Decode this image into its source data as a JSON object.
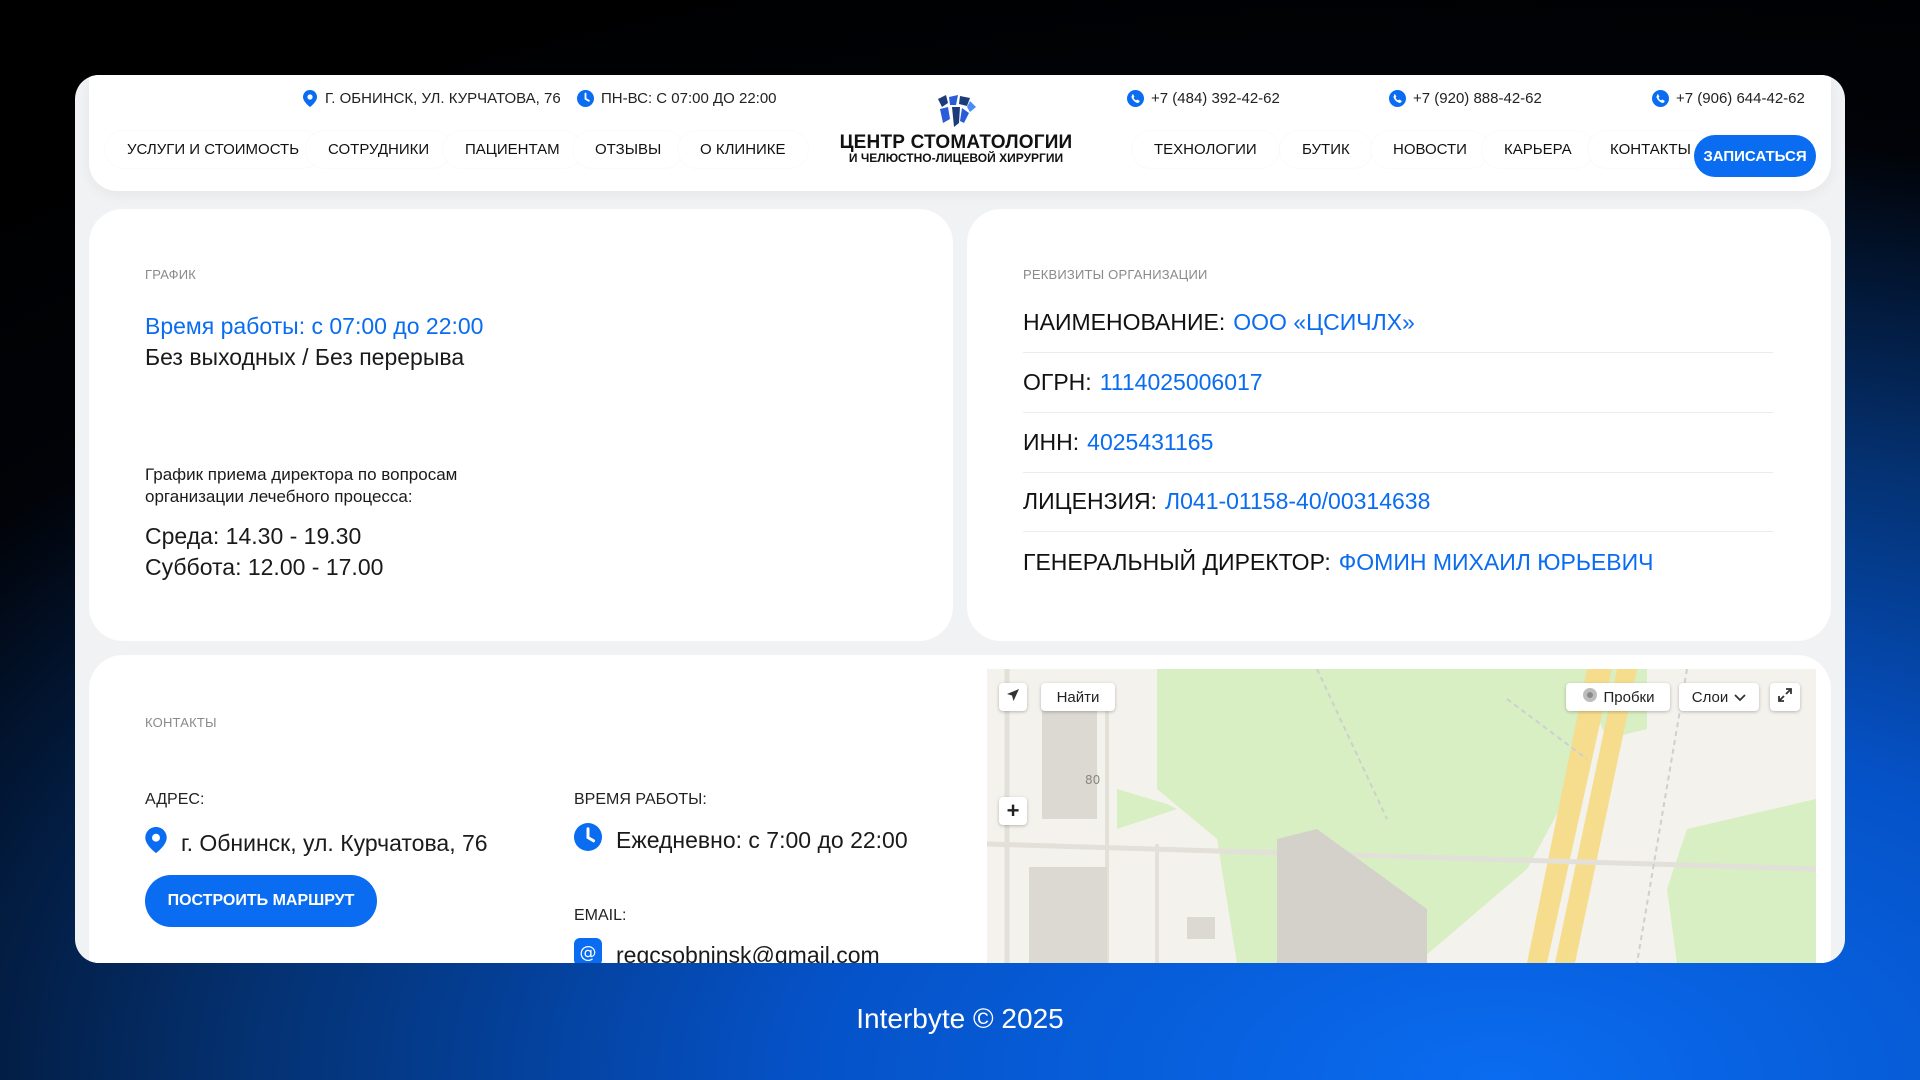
{
  "topbar": {
    "address": "Г. ОБНИНСК, УЛ. КУРЧАТОВА, 76",
    "hours": "ПН-ВС: С 07:00 ДО 22:00",
    "phones": [
      "+7 (484) 392-42-62",
      "+7 (920) 888-42-62",
      "+7 (906) 644-42-62"
    ]
  },
  "logo": {
    "line1": "ЦЕНТР СТОМАТОЛОГИИ",
    "line2": "И ЧЕЛЮСТНО-ЛИЦЕВОЙ ХИРУРГИИ"
  },
  "nav_left": [
    "УСЛУГИ И СТОИМОСТЬ",
    "СОТРУДНИКИ",
    "ПАЦИЕНТАМ",
    "ОТЗЫВЫ",
    "О КЛИНИКЕ"
  ],
  "nav_right": [
    "ТЕХНОЛОГИИ",
    "БУТИК",
    "НОВОСТИ",
    "КАРЬЕРА",
    "КОНТАКТЫ"
  ],
  "nav_cta": "ЗАПИСАТЬСЯ",
  "schedule": {
    "section_label": "ГРАФИК",
    "hours_title": "Время работы: с 07:00 до 22:00",
    "hours_sub": "Без выходных / Без перерыва",
    "director_note_1": "График приема директора по вопросам",
    "director_note_2": "организации лечебного процесса:",
    "day1": "Среда: 14.30 - 19.30",
    "day2": "Суббота: 12.00 - 17.00"
  },
  "requisites": {
    "section_label": "РЕКВИЗИТЫ ОРГАНИЗАЦИИ",
    "rows": [
      {
        "key": "НАИМЕНОВАНИЕ:",
        "value": "ООО «ЦСИЧЛХ»"
      },
      {
        "key": "ОГРН:",
        "value": "1114025006017"
      },
      {
        "key": "ИНН:",
        "value": "4025431165"
      },
      {
        "key": "ЛИЦЕНЗИЯ:",
        "value": "Л041-01158-40/00314638"
      },
      {
        "key": "ГЕНЕРАЛЬНЫЙ ДИРЕКТОР:",
        "value": "ФОМИН МИХАИЛ ЮРЬЕВИЧ"
      }
    ]
  },
  "contacts": {
    "section_label": "КОНТАКТЫ",
    "address_label": "АДРЕС:",
    "address": "г. Обнинск, ул. Курчатова, 76",
    "route_button": "ПОСТРОИТЬ МАРШРУТ",
    "hours_label": "ВРЕМЯ РАБОТЫ:",
    "hours": "Ежедневно: с 7:00 до 22:00",
    "email_label": "EMAIL:",
    "email": "regcsobninsk@gmail.com"
  },
  "map": {
    "find_button": "Найти",
    "traffic_button": "Пробки",
    "layers_button": "Слои",
    "house_number": "80"
  },
  "footer": "Interbyte © 2025",
  "colors": {
    "accent": "#0a6cf0",
    "frame": "#f1f2f4"
  }
}
